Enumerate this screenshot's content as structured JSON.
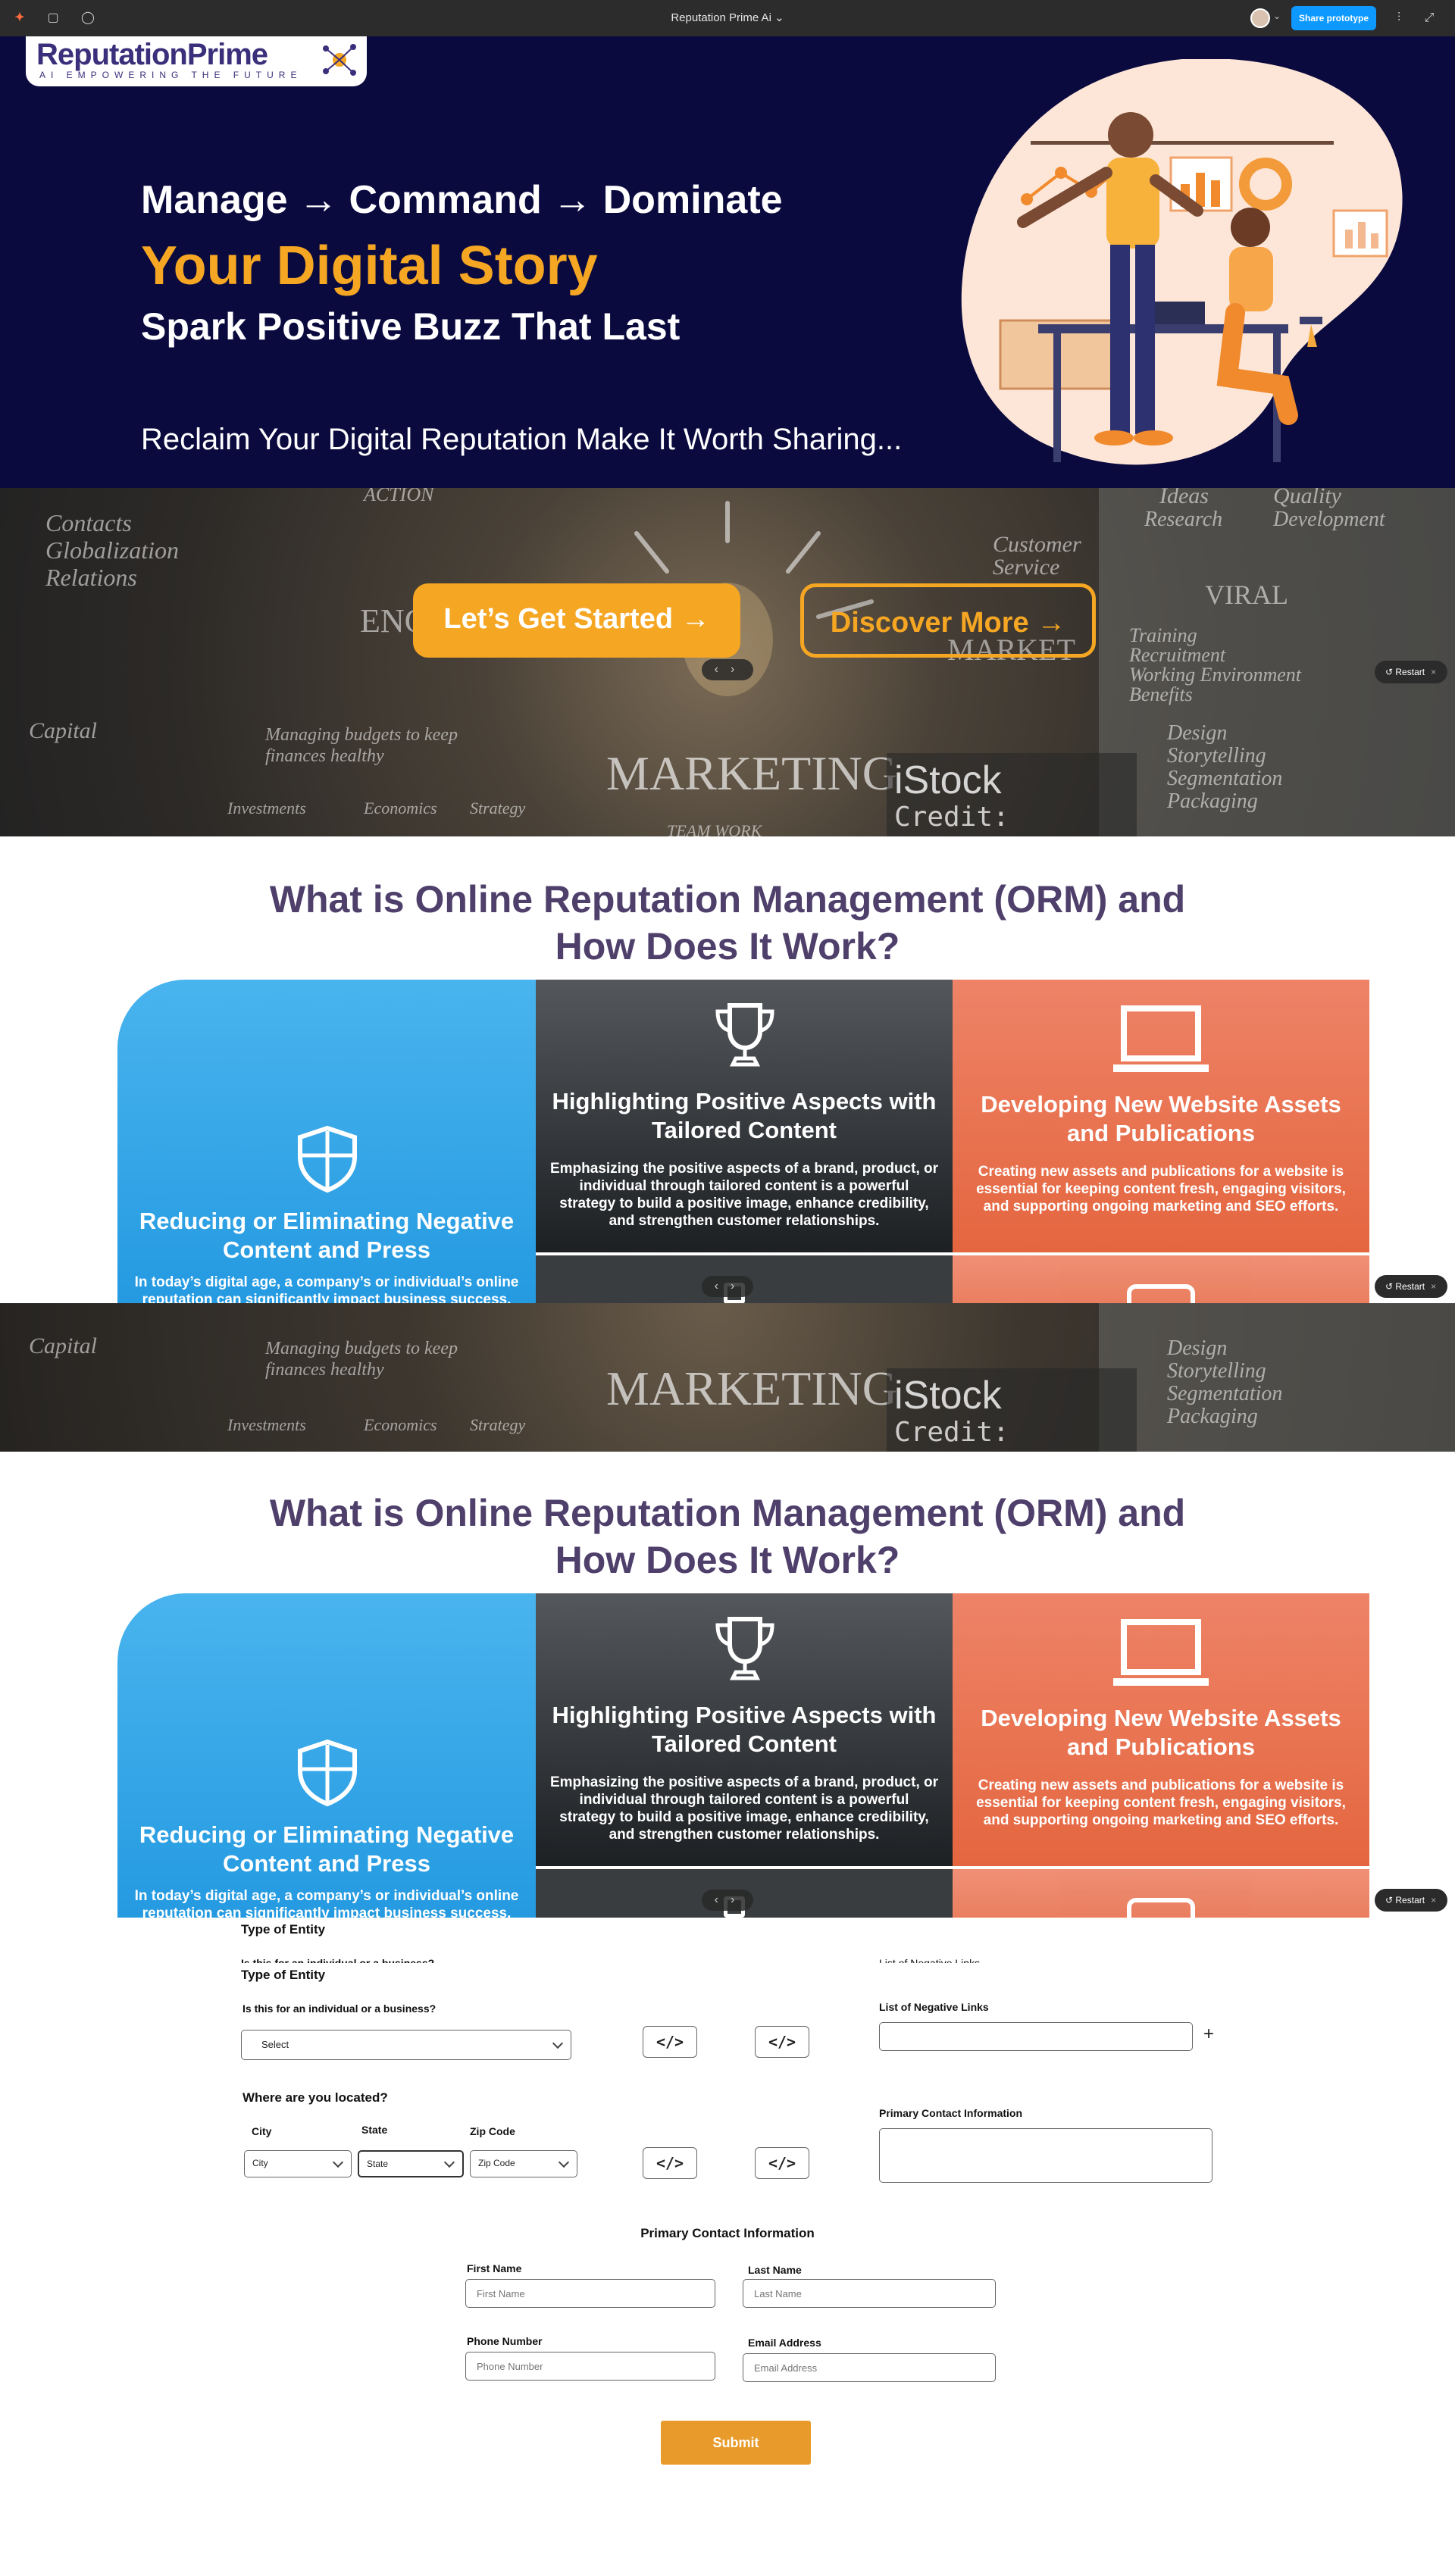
{
  "toolbar": {
    "title": "Reputation Prime Ai",
    "share_label": "Share prototype",
    "colors": {
      "bar": "#2c2c2c",
      "share": "#0d99ff"
    }
  },
  "hero": {
    "logo_name": "ReputationPrime",
    "logo_tagline": "AI EMPOWERING THE FUTURE",
    "line1": "Manage → Command → Dominate",
    "line2": "Your Digital Story",
    "line3": "Spark Positive Buzz That Last",
    "tagline": "Reclaim Your Digital Reputation Make It Worth Sharing...",
    "colors": {
      "background": "#0a0a3f",
      "accent": "#f5a623"
    }
  },
  "banner": {
    "chalk_words": [
      "Contacts",
      "Globalization",
      "Relations",
      "ACTION",
      "ENGA",
      "Capital",
      "Managing budgets to keep finances healthy",
      "Investments",
      "Economics",
      "Strategy",
      "Ideas",
      "Quality",
      "Research",
      "Development",
      "Customer Service",
      "VIRAL",
      "Training",
      "Recruitment",
      "Working Environment",
      "Benefits",
      "Design",
      "Storytelling",
      "Segmentation",
      "Packaging",
      "TEAM WORK"
    ],
    "marketing_word": "MARKETING",
    "watermark_brand": "iStock",
    "watermark_credit": "Credit: andresr",
    "cta_primary": "Let’s Get Started →",
    "cta_secondary": "Discover More →",
    "restart_label": "Restart",
    "nav_prev": "‹",
    "nav_next": "›"
  },
  "orm": {
    "title_line1": "What is Online Reputation Management (ORM) and",
    "title_line2": "How Does It Work?",
    "cards": [
      {
        "icon": "shield-icon",
        "title": "Reducing or Eliminating Negative Content and Press",
        "text": "In today’s digital age, a company’s or individual’s online reputation can significantly impact business success."
      },
      {
        "icon": "trophy-icon",
        "title": "Highlighting Positive Aspects with Tailored Content",
        "text": "Emphasizing the positive aspects of a brand, product, or individual through tailored content is a powerful strategy to build a positive image, enhance credibility, and strengthen customer relationships."
      },
      {
        "icon": "laptop-icon",
        "title": "Developing New Website Assets and Publications",
        "text": "Creating new assets and publications for a website is essential for keeping content fresh, engaging visitors, and supporting ongoing marketing and SEO efforts."
      }
    ]
  },
  "form": {
    "ghost_type_label": "Type of Entity",
    "ghost_question": "Is this for an individual or a business?",
    "ghost_links_label": "List of Negative Links",
    "type_label": "Type of Entity",
    "type_question": "Is this for an individual or a business?",
    "type_select": "Select",
    "code_glyph": "</>",
    "location_label": "Where are you located?",
    "city_label": "City",
    "state_label": "State",
    "zip_label": "Zip Code",
    "city_value": "City",
    "state_value": "State",
    "zip_value": "Zip Code",
    "links_label": "List of Negative Links",
    "links_add": "+",
    "contact_side_label": "Primary Contact Information",
    "contact_heading": "Primary Contact Information",
    "first_name_label": "First Name",
    "first_name_placeholder": "First Name",
    "last_name_label": "Last Name",
    "last_name_placeholder": "Last Name",
    "phone_label": "Phone Number",
    "phone_placeholder": "Phone Number",
    "email_label": "Email Address",
    "email_placeholder": "Email Address",
    "submit_label": "Submit",
    "submit_color": "#e89b2a"
  }
}
